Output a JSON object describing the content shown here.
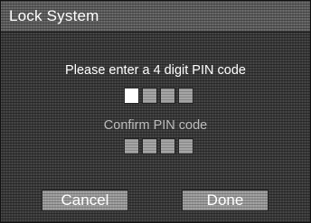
{
  "window": {
    "title": "Lock System"
  },
  "pin_entry": {
    "prompt": "Please enter a 4 digit PIN code",
    "digits": 4,
    "active_index": 0
  },
  "pin_confirm": {
    "prompt": "Confirm PIN code",
    "digits": 4
  },
  "buttons": {
    "cancel_label": "Cancel",
    "done_label": "Done"
  },
  "colors": {
    "background": "#3a3a3a",
    "title_bar": "#5e5e5e",
    "text": "#ffffff",
    "disabled_text": "#bcbcbc",
    "pin_box": "#a5a5a5",
    "pin_box_active": "#ffffff",
    "button": "#9a9a9a"
  }
}
